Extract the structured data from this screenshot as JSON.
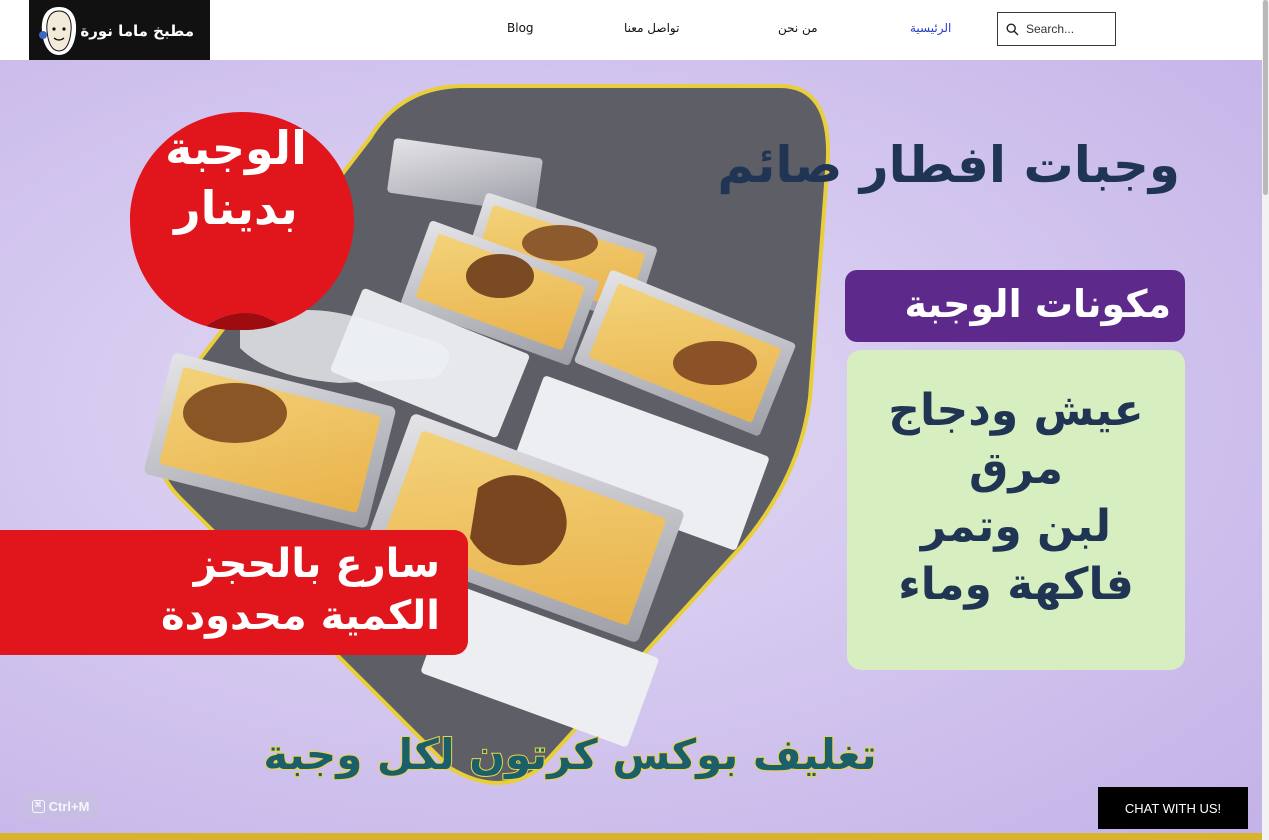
{
  "header": {
    "logo_text": "مطبخ ماما نورة",
    "nav": {
      "home": "الرئيسية",
      "about": "من نحن",
      "contact": "تواصل معنا",
      "blog": "Blog"
    },
    "search_placeholder": "Search..."
  },
  "hero": {
    "badge_line1": "الوجبة",
    "badge_line2": "بدينار",
    "title": "وجبات افطار صائم",
    "ingredients_label": "مكونات الوجبة",
    "ingredients": [
      "عيش ودجاج",
      "مرق",
      "لبن وتمر",
      "فاكهة وماء"
    ],
    "urgency_line1": "سارع بالحجز",
    "urgency_line2": "الكمية محدودة",
    "packaging": "تغليف بوكس كرتون لكل وجبة"
  },
  "shortcut_hint": "Ctrl+M",
  "chat_button": "CHAT WITH US!",
  "colors": {
    "hero_bg": "#d4c8ef",
    "badge_red": "#e0161c",
    "label_purple": "#5d2a8c",
    "ingredients_bg": "#d7eec1",
    "title_navy": "#1f3553",
    "nav_active": "#2a3ec8"
  }
}
